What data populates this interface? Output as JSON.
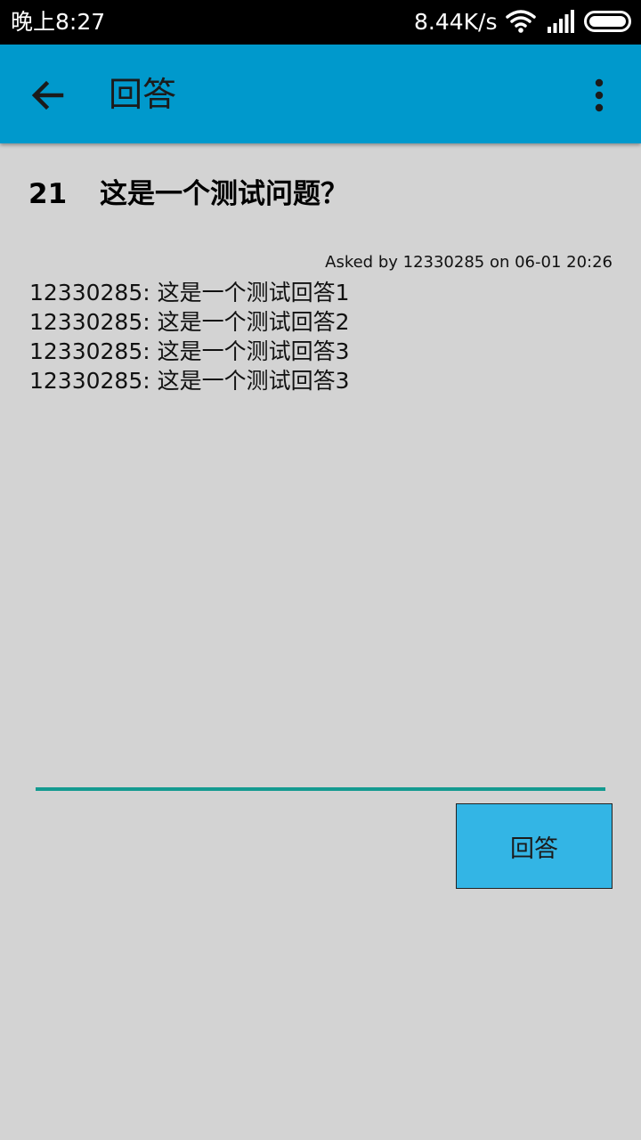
{
  "status_bar": {
    "time": "晚上8:27",
    "network_speed": "8.44K/s",
    "icons": [
      "wifi-icon",
      "signal-icon",
      "battery-icon"
    ]
  },
  "app_bar": {
    "title": "回答",
    "background_color": "#0099cc",
    "back_icon": "arrow-left-icon",
    "menu_icon": "more-vertical-icon"
  },
  "question": {
    "number": "21",
    "text": "这是一个测试问题？",
    "asked_by": "Asked by 12330285 on 06-01 20:26"
  },
  "answers": [
    "12330285: 这是一个测试回答1",
    "12330285: 这是一个测试回答2",
    "12330285: 这是一个测试回答3",
    "12330285: 这是一个测试回答3"
  ],
  "answer_form": {
    "input_value": "",
    "input_underline_color": "#139a90",
    "submit_label": "回答",
    "submit_color": "#33b5e5"
  }
}
